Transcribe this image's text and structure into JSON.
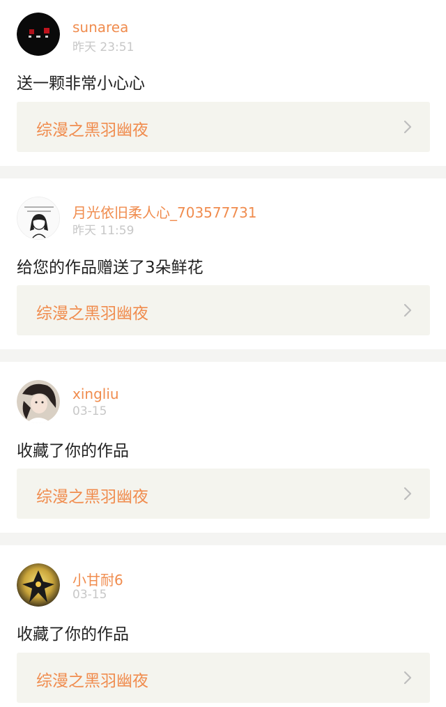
{
  "notifications": [
    {
      "avatar_icon": "avatar-dark-pattern-icon",
      "username": "sunarea",
      "time": "昨天  23:51",
      "message": "送一颗非常小心心",
      "work_title": "综漫之黑羽幽夜"
    },
    {
      "avatar_icon": "avatar-sketch-girl-icon",
      "username": "月光依旧柔人心_703577731",
      "time": "昨天  11:59",
      "message": "给您的作品赠送了3朵鲜花",
      "work_title": "综漫之黑羽幽夜"
    },
    {
      "avatar_icon": "avatar-girl-photo-icon",
      "username": "xingliu",
      "time": "03-15",
      "message": "收藏了你的作品",
      "work_title": "综漫之黑羽幽夜"
    },
    {
      "avatar_icon": "avatar-anime-figure-icon",
      "username": "小甘耐6",
      "time": "03-15",
      "message": "收藏了你的作品",
      "work_title": "综漫之黑羽幽夜"
    }
  ],
  "colors": {
    "username": "#f08c4e",
    "time": "#c7c7c7",
    "message": "#222222",
    "link_bg": "#f4f4ee",
    "separator": "#f4f4f2",
    "chevron": "#bdbdbd"
  }
}
